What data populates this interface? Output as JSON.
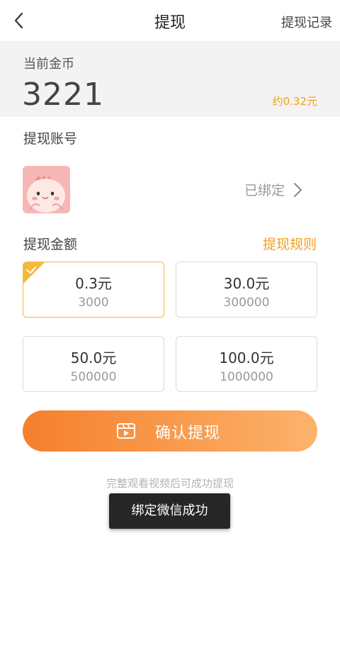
{
  "header": {
    "title": "提现",
    "records_link": "提现记录",
    "back_icon": "chevron-left-icon"
  },
  "balance": {
    "label": "当前金币",
    "value": "3221",
    "yuan_equiv": "约0.32元"
  },
  "account": {
    "label": "提现账号",
    "status": "已绑定",
    "avatar_icon": "cartoon-avatar-icon",
    "chevron_icon": "chevron-right-icon"
  },
  "amount": {
    "label": "提现金额",
    "rules_link": "提现规则",
    "options": [
      {
        "yuan": "0.3元",
        "coins": "3000",
        "selected": true
      },
      {
        "yuan": "30.0元",
        "coins": "300000",
        "selected": false
      },
      {
        "yuan": "50.0元",
        "coins": "500000",
        "selected": false
      },
      {
        "yuan": "100.0元",
        "coins": "1000000",
        "selected": false
      }
    ]
  },
  "confirm": {
    "label": "确认提现",
    "icon": "video-play-icon"
  },
  "hint": "完整观看视频后可成功提现",
  "toast": "绑定微信成功",
  "colors": {
    "accent": "#f0a020",
    "button_start": "#f57f2c",
    "button_end": "#fcb36c",
    "selected_border": "#f5b93a"
  }
}
